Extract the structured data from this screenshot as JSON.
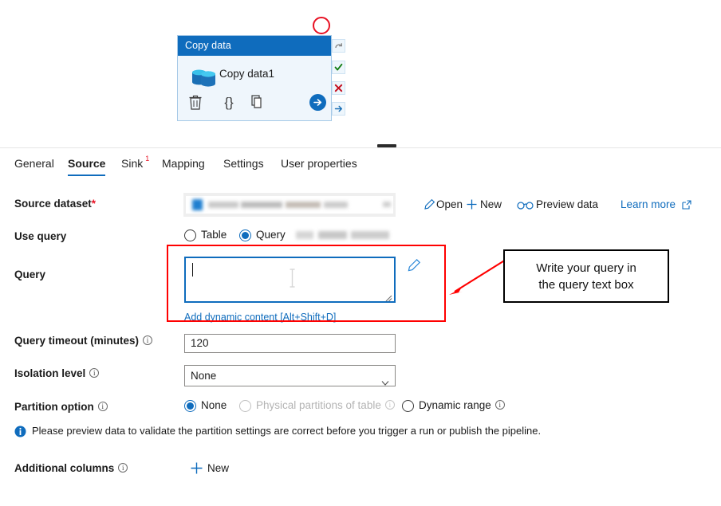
{
  "canvas": {
    "activity": {
      "header_title": "Copy data",
      "name": "Copy data1",
      "tools": [
        {
          "name": "delete-icon",
          "label": "Delete"
        },
        {
          "name": "code-icon",
          "label": "{}"
        },
        {
          "name": "duplicate-icon",
          "label": "Duplicate"
        },
        {
          "name": "run-icon",
          "label": "Go"
        }
      ],
      "handles": [
        {
          "name": "skipped-handle",
          "label": "Skipped"
        },
        {
          "name": "success-handle",
          "label": "Success"
        },
        {
          "name": "failure-handle",
          "label": "Failure"
        },
        {
          "name": "completion-handle",
          "label": "Completion"
        }
      ]
    },
    "annotation_circle_color": "#e81123"
  },
  "tabs": [
    {
      "label": "General",
      "active": false,
      "badge": ""
    },
    {
      "label": "Source",
      "active": true,
      "badge": ""
    },
    {
      "label": "Sink",
      "active": false,
      "badge": "1"
    },
    {
      "label": "Mapping",
      "active": false,
      "badge": ""
    },
    {
      "label": "Settings",
      "active": false,
      "badge": ""
    },
    {
      "label": "User properties",
      "active": false,
      "badge": ""
    }
  ],
  "form": {
    "source_dataset": {
      "label": "Source dataset",
      "required_marker": "*",
      "value": "",
      "actions": [
        {
          "label": "Open",
          "icon": "pencil-icon"
        },
        {
          "label": "New",
          "icon": "plus-icon"
        },
        {
          "label": "Preview data",
          "icon": "glasses-icon"
        },
        {
          "label": "Learn more",
          "icon": "external-link-icon"
        }
      ]
    },
    "use_query": {
      "label": "Use query",
      "options": [
        {
          "label": "Table",
          "selected": false,
          "disabled": false
        },
        {
          "label": "Query",
          "selected": true,
          "disabled": false
        }
      ]
    },
    "query": {
      "label": "Query",
      "value": "",
      "dynamic_content_link": "Add dynamic content [Alt+Shift+D]"
    },
    "query_timeout": {
      "label": "Query timeout (minutes)",
      "value": "120"
    },
    "isolation_level": {
      "label": "Isolation level",
      "value": "None"
    },
    "partition_option": {
      "label": "Partition option",
      "options": [
        {
          "label": "None",
          "selected": true,
          "disabled": false
        },
        {
          "label": "Physical partitions of table",
          "selected": false,
          "disabled": true
        },
        {
          "label": "Dynamic range",
          "selected": false,
          "disabled": false
        }
      ]
    },
    "info_banner": {
      "text": "Please preview data to validate the partition settings are correct before you trigger a run or publish the pipeline."
    },
    "additional_columns": {
      "label": "Additional columns",
      "new_label": "New"
    }
  },
  "annotation": {
    "callout_line1": "Write your query in",
    "callout_line2": "the query text box",
    "arrow_color": "#ff0000",
    "highlight_color": "#ff0000"
  },
  "colors": {
    "accent": "#0f6cbd",
    "card_header": "#0f6cbd",
    "card_body": "#eff6fc",
    "success": "#107c10",
    "failure": "#c50f1f",
    "annotation": "#ff0000"
  }
}
